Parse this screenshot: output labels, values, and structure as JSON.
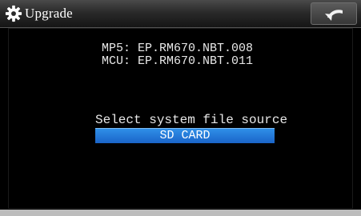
{
  "header": {
    "title": "Upgrade",
    "icon": "gear-icon",
    "back_icon": "back-arrow-icon"
  },
  "versions": {
    "mp5": "MP5: EP.RM670.NBT.008",
    "mcu": "MCU: EP.RM670.NBT.011"
  },
  "source": {
    "label": "Select system file source",
    "options": [
      {
        "label": "SD CARD",
        "selected": true
      }
    ]
  },
  "colors": {
    "selected_option": "#2a7fe0",
    "background": "#000000"
  }
}
